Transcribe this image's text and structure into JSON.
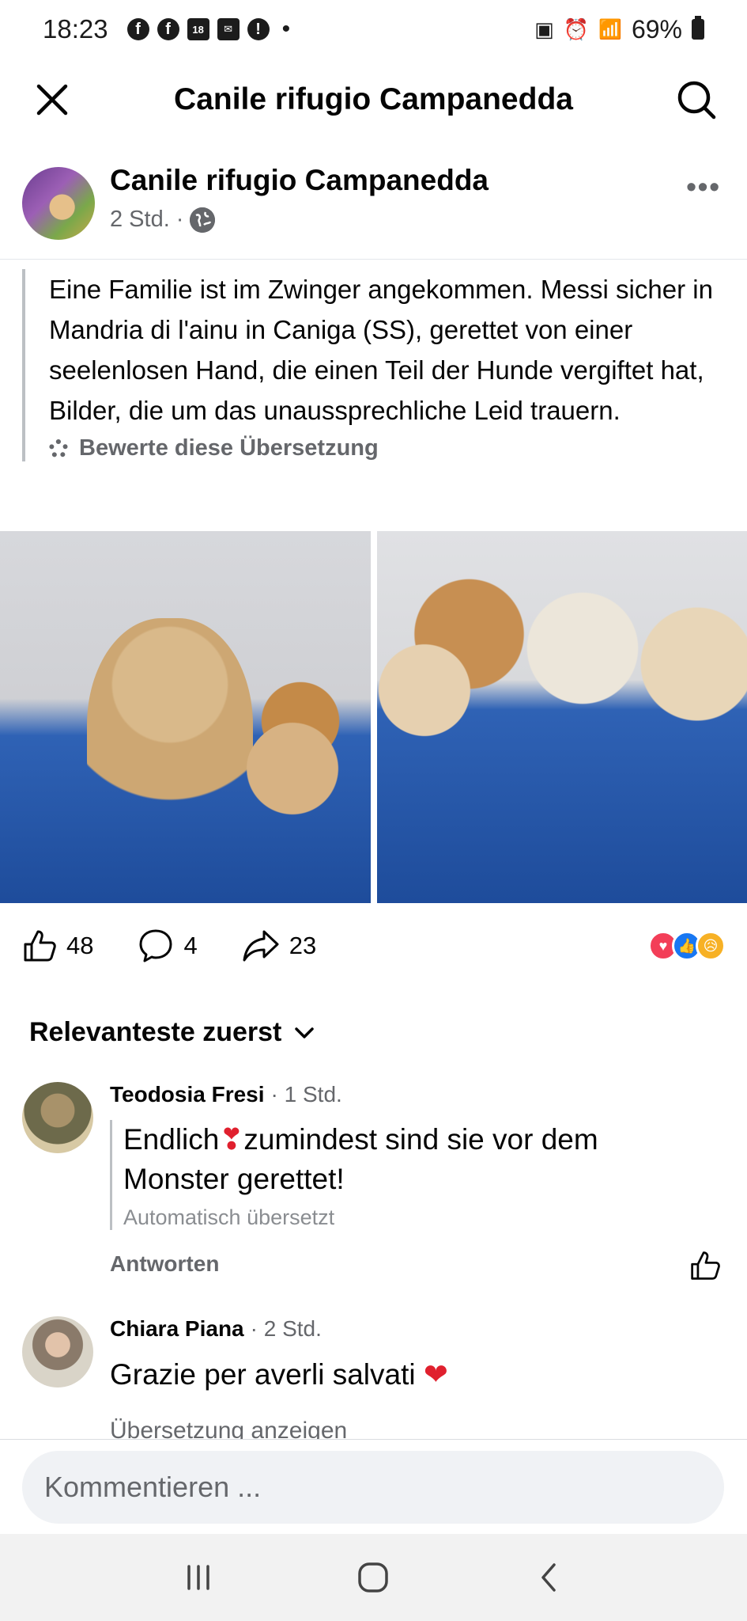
{
  "status_bar": {
    "time": "18:23",
    "notif_badge": "18",
    "battery": "69%"
  },
  "header": {
    "title": "Canile rifugio Campanedda"
  },
  "post": {
    "page_name": "Canile rifugio Campanedda",
    "time": "2 Std.",
    "separator": "·",
    "text": "Eine Familie ist im Zwinger angekommen. Messi sicher in Mandria di l'ainu in Caniga (SS), gerettet von einer seelenlosen Hand, die einen Teil der Hunde vergiftet hat, Bilder, die um das unaussprechliche Leid trauern.",
    "rate_translation": "Bewerte diese Übersetzung",
    "likes": "48",
    "comments": "4",
    "shares": "23"
  },
  "sort": {
    "label": "Relevanteste zuerst"
  },
  "comments": [
    {
      "author": "Teodosia Fresi",
      "time": "· 1 Std.",
      "text_before": "Endlich",
      "text_after": "zumindest sind sie vor dem Monster gerettet!",
      "auto_translated": "Automatisch übersetzt",
      "reply": "Antworten"
    },
    {
      "author": "Chiara Piana",
      "time": "· 2 Std.",
      "text": "Grazie per averli salvati",
      "show_translation": "Übersetzung anzeigen"
    }
  ],
  "comment_input": {
    "placeholder": "Kommentieren ..."
  }
}
